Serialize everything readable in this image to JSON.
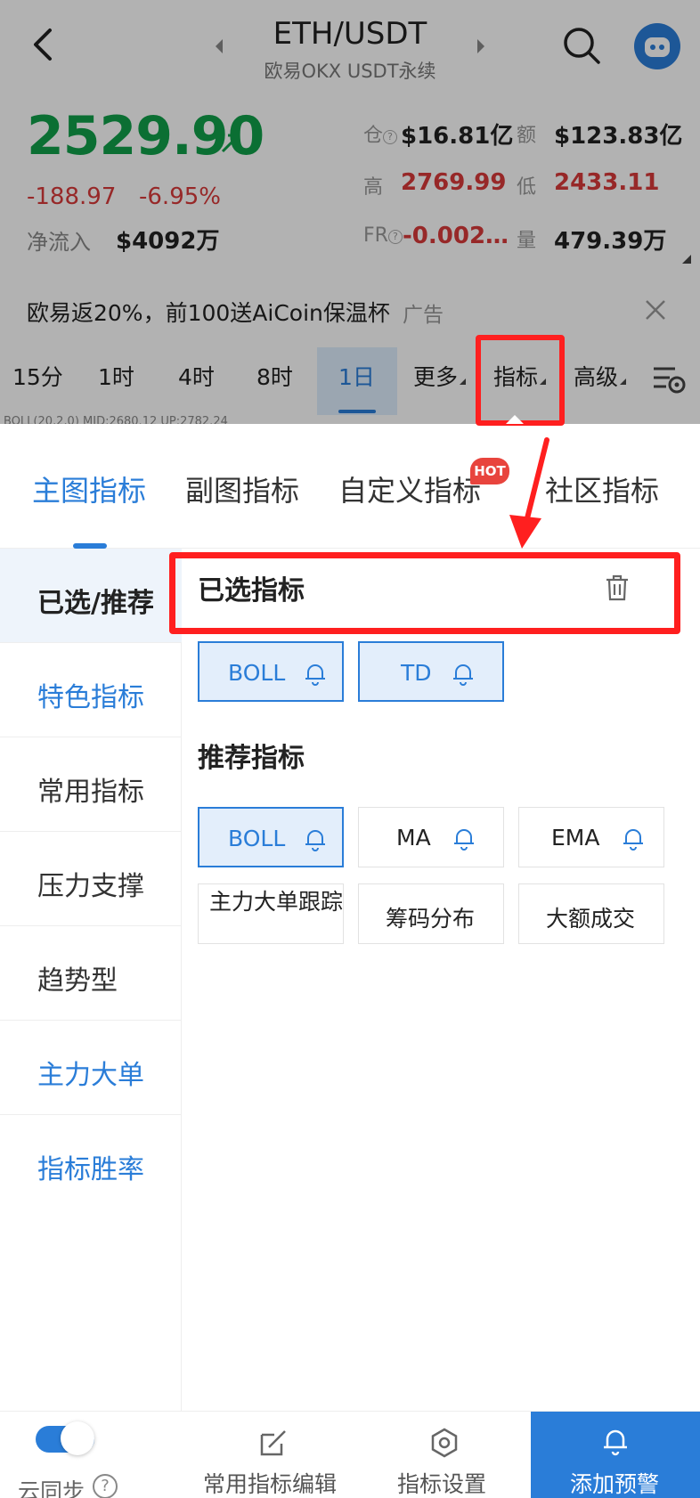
{
  "header": {
    "pair": "ETH/USDT",
    "exchange": "欧易OKX USDT永续"
  },
  "price": {
    "last": "2529.90",
    "change": "-188.97",
    "change_pct": "-6.95%",
    "netflow_label": "净流入",
    "netflow_value": "$4092万"
  },
  "stats": {
    "oi_label": "仓",
    "oi_value": "$16.81亿",
    "amount_label": "额",
    "amount_value": "$123.83亿",
    "high_label": "高",
    "high_value": "2769.99",
    "low_label": "低",
    "low_value": "2433.11",
    "fr_label": "FR",
    "fr_value": "-0.002…",
    "vol_label": "量",
    "vol_value": "479.39万",
    "help_glyph": "?"
  },
  "ad": {
    "text": "欧易返20%，前100送AiCoin保温杯",
    "tag": "广告"
  },
  "timeframes": {
    "items": [
      "15分",
      "1时",
      "4时",
      "8时",
      "1日"
    ],
    "more": "更多",
    "indicators": "指标",
    "advanced": "高级",
    "boll_line": "BOLL(20,2,0)  MID:2680.12  UP:2782.24"
  },
  "tabs": {
    "main": "主图指标",
    "sub": "副图指标",
    "custom": "自定义指标",
    "hot": "HOT",
    "community": "社区指标"
  },
  "sidebar": {
    "items": [
      "已选/推荐",
      "特色指标",
      "常用指标",
      "压力支撑",
      "趋势型",
      "主力大单",
      "指标胜率"
    ]
  },
  "selected": {
    "title": "已选指标",
    "chips": [
      "BOLL",
      "TD"
    ]
  },
  "recommended": {
    "title": "推荐指标",
    "chips": [
      "BOLL",
      "MA",
      "EMA",
      "主力大单跟踪",
      "筹码分布",
      "大额成交"
    ]
  },
  "footer": {
    "sync": "云同步",
    "help_glyph": "?",
    "edit": "常用指标编辑",
    "settings": "指标设置",
    "alert": "添加预警"
  },
  "colors": {
    "accent": "#2a7dd8",
    "up": "#11a04a",
    "down": "#d83a3a",
    "highlight": "#ff1f1f"
  }
}
